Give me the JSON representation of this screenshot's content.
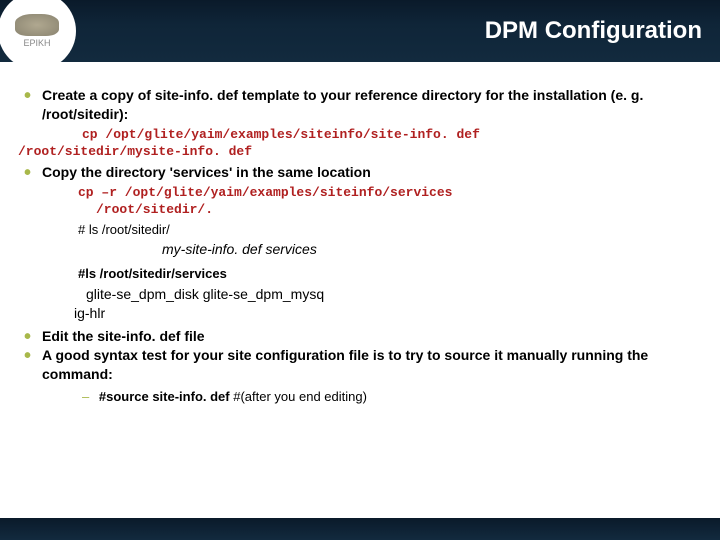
{
  "header": {
    "logo_text": "EPIKH",
    "title": "DPM Configuration"
  },
  "bullets": {
    "b1": "Create a copy of site-info. def template to your reference directory for the installation (e. g. /root/sitedir):",
    "b1_cmd_l1": "cp /opt/glite/yaim/examples/siteinfo/site-info. def",
    "b1_cmd_l2": "/root/sitedir/mysite-info. def",
    "b2": "Copy the directory 'services'  in the same location",
    "b2_cmd_l1": "cp –r /opt/glite/yaim/examples/siteinfo/services",
    "b2_cmd_l2": "/root/sitedir/.",
    "ls1": "# ls /root/sitedir/",
    "result1": "my-site-info. def services",
    "ls2": "#ls /root/sitedir/services",
    "result2a": "glite-se_dpm_disk  glite-se_dpm_mysq",
    "result2b": "ig-hlr",
    "b3": "Edit the site-info. def file",
    "b4": "A good syntax test for your site configuration file is to try to source it manually running the command:",
    "dash_bold": "#source site-info. def",
    "dash_rest": "   #(after you end editing)"
  }
}
